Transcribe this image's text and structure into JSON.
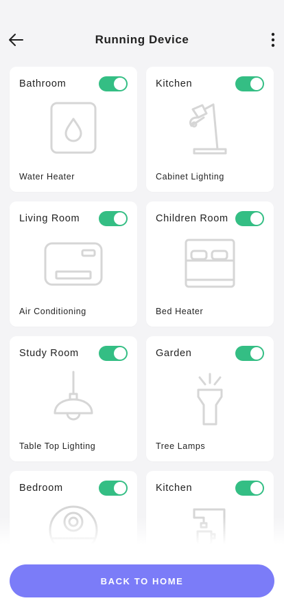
{
  "header": {
    "title": "Running Device",
    "back_icon": "arrow-left-icon",
    "more_icon": "more-vertical-icon"
  },
  "colors": {
    "toggle_on": "#34be84",
    "primary_button": "#7b7cf8",
    "icon_stroke": "#d6d6d6"
  },
  "devices": [
    {
      "room": "Bathroom",
      "name": "Water Heater",
      "on": true,
      "icon": "water-heater-icon"
    },
    {
      "room": "Kitchen",
      "name": "Cabinet Lighting",
      "on": true,
      "icon": "desk-lamp-icon"
    },
    {
      "room": "Living Room",
      "name": "Air Conditioning",
      "on": true,
      "icon": "air-conditioner-icon"
    },
    {
      "room": "Children Room",
      "name": "Bed Heater",
      "on": true,
      "icon": "bed-icon"
    },
    {
      "room": "Study Room",
      "name": "Table Top Lighting",
      "on": true,
      "icon": "pendant-lamp-icon"
    },
    {
      "room": "Garden",
      "name": "Tree Lamps",
      "on": true,
      "icon": "flashlight-icon"
    },
    {
      "room": "Bedroom",
      "name": "",
      "on": true,
      "icon": "robot-vacuum-icon"
    },
    {
      "room": "Kitchen",
      "name": "",
      "on": true,
      "icon": "coffee-machine-icon"
    }
  ],
  "footer": {
    "button_label": "BACK TO HOME"
  }
}
